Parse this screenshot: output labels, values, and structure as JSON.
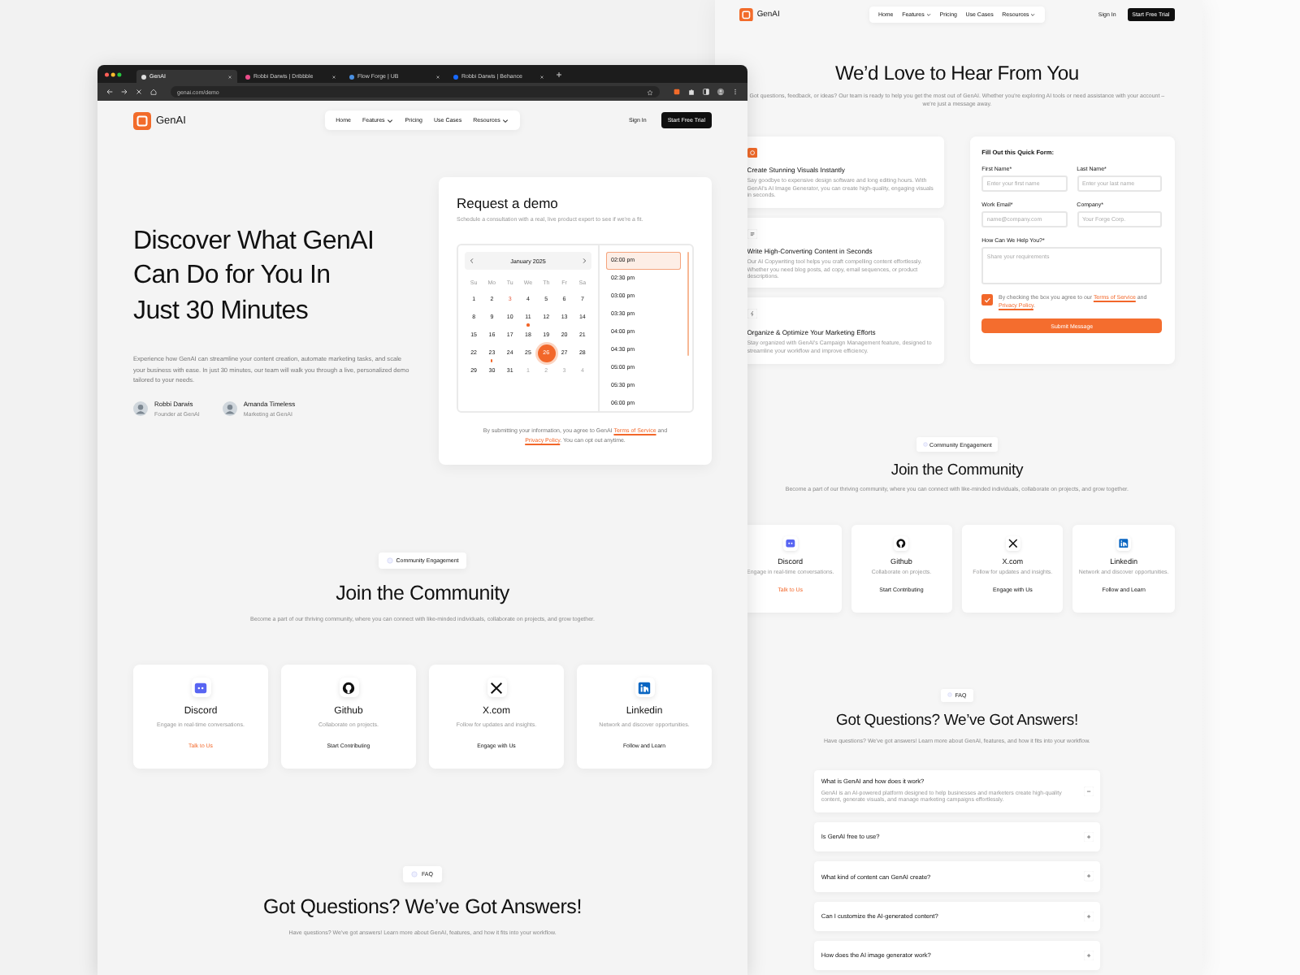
{
  "contact_page": {
    "brand": "GenAI",
    "nav": [
      {
        "label": "Home",
        "dropdown": false
      },
      {
        "label": "Features",
        "dropdown": true
      },
      {
        "label": "Pricing",
        "dropdown": false
      },
      {
        "label": "Use Cases",
        "dropdown": false
      },
      {
        "label": "Resources",
        "dropdown": true
      }
    ],
    "sign_in": "Sign In",
    "cta": "Start Free Trial",
    "title": "We’d Love to Hear From You",
    "text": "Got questions, feedback, or ideas? Our team is ready to help you get the most out of GenAI. Whether you're exploring AI tools or need assistance with your account – we're just a message away.",
    "features": [
      {
        "title": "Create Stunning Visuals Instantly",
        "text": "Say goodbye to expensive design software and long editing hours. With GenAI's AI Image Generator, you can create high-quality, engaging visuals in seconds."
      },
      {
        "title": "Write High-Converting Content in Seconds",
        "text": "Our AI Copywriting tool helps you craft compelling content effortlessly. Whether you need blog posts, ad copy, email sequences, or product descriptions."
      },
      {
        "title": "Organize & Optimize Your Marketing Efforts",
        "text": "Stay organized with GenAI's Campaign Management feature, designed to streamline your workflow and improve efficiency."
      }
    ],
    "form": {
      "title": "Fill Out this Quick Form:",
      "fields": [
        {
          "label": "First Name*",
          "placeholder": "Enter your first name",
          "kind": "input"
        },
        {
          "label": "Last Name*",
          "placeholder": "Enter your last name",
          "kind": "input"
        },
        {
          "label": "Work Email*",
          "placeholder": "name@company.com",
          "kind": "input"
        },
        {
          "label": "Company*",
          "placeholder": "Your Forge Corp.",
          "kind": "input"
        },
        {
          "label": "How Can We Help You?*",
          "placeholder": "Share your requirements",
          "kind": "textarea"
        }
      ],
      "consent": {
        "checked": true,
        "before": "By checking the box you agree to our",
        "terms": "Terms of Service",
        "and": "and",
        "privacy": "Privacy Policy",
        "after": "."
      },
      "submit": "Submit Message"
    },
    "community": {
      "badge": "Community Engagement",
      "title": "Join the Community",
      "text": "Become a part of our thriving community, where you can connect with like-minded individuals, collaborate on projects, and grow together.",
      "cards": [
        {
          "name": "Discord",
          "text": "Engage in real-time conversations.",
          "action": "Talk to Us",
          "highlighted": true
        },
        {
          "name": "Github",
          "text": "Collaborate on projects.",
          "action": "Start Contributing",
          "highlighted": false
        },
        {
          "name": "X.com",
          "text": "Follow for updates and insights.",
          "action": "Engage with Us",
          "highlighted": false
        },
        {
          "name": "Linkedin",
          "text": "Network and discover opportunities.",
          "action": "Follow and Learn",
          "highlighted": false
        }
      ]
    },
    "faq": {
      "badge": "FAQ",
      "title": "Got Questions? We’ve Got Answers!",
      "text": "Have questions? We've got answers! Learn more about GenAI, features, and how it fits into your workflow.",
      "items": [
        {
          "question": "What is GenAI and how does it work?",
          "expanded": true,
          "answer": "GenAI is an AI-powered platform designed to help businesses and marketers create high-quality content, generate visuals, and manage marketing campaigns effortlessly."
        },
        {
          "question": "Is GenAI free to use?",
          "expanded": false
        },
        {
          "question": "What kind of content can GenAI create?",
          "expanded": false
        },
        {
          "question": "Can I customize the AI-generated content?",
          "expanded": false
        },
        {
          "question": "How does the AI image generator work?",
          "expanded": false
        }
      ]
    }
  },
  "browser": {
    "tabs": [
      {
        "label": "GenAI",
        "selected": true
      },
      {
        "label": "Robbi Darwis | Dribbble",
        "selected": false
      },
      {
        "label": "Flow Forge | UB",
        "selected": false
      },
      {
        "label": "Robbi Darwis | Behance",
        "selected": false
      }
    ],
    "address": "genai.com/demo"
  },
  "demo_page": {
    "brand": "GenAI",
    "nav": [
      {
        "label": "Home",
        "dropdown": false
      },
      {
        "label": "Features",
        "dropdown": true
      },
      {
        "label": "Pricing",
        "dropdown": false
      },
      {
        "label": "Use Cases",
        "dropdown": false
      },
      {
        "label": "Resources",
        "dropdown": true
      }
    ],
    "sign_in": "Sign In",
    "cta": "Start Free Trial",
    "hero": {
      "title": "Discover What GenAI\nCan Do for You In\nJust 30 Minutes",
      "text": "Experience how GenAI can streamline your content creation, automate marketing tasks, and scale your business with ease. In just 30 minutes, our team will walk you through a live, personalized demo tailored to your needs.",
      "people": [
        {
          "name": "Robbi Darwis",
          "role": "Founder at GenAI"
        },
        {
          "name": "Amanda Timeless",
          "role": "Marketing at GenAI"
        }
      ]
    },
    "request": {
      "title": "Request a demo",
      "subtitle": "Schedule a consultation with a real, live product expert to see if we're a fit.",
      "month": "January 2025",
      "weekdays": [
        "Su",
        "Mo",
        "Tu",
        "We",
        "Th",
        "Fr",
        "Sa"
      ],
      "days": [
        {
          "label": "1",
          "selected": false,
          "muted": false,
          "today": false,
          "dot": false
        },
        {
          "label": "2",
          "selected": false,
          "muted": false,
          "today": false,
          "dot": false
        },
        {
          "label": "3",
          "selected": false,
          "muted": false,
          "today": true,
          "dot": false
        },
        {
          "label": "4",
          "selected": false,
          "muted": false,
          "today": false,
          "dot": false
        },
        {
          "label": "5",
          "selected": false,
          "muted": false,
          "today": false,
          "dot": false
        },
        {
          "label": "6",
          "selected": false,
          "muted": false,
          "today": false,
          "dot": false
        },
        {
          "label": "7",
          "selected": false,
          "muted": false,
          "today": false,
          "dot": false
        },
        {
          "label": "8",
          "selected": false,
          "muted": false,
          "today": false,
          "dot": false
        },
        {
          "label": "9",
          "selected": false,
          "muted": false,
          "today": false,
          "dot": false
        },
        {
          "label": "10",
          "selected": false,
          "muted": false,
          "today": false,
          "dot": false
        },
        {
          "label": "11",
          "selected": false,
          "muted": false,
          "today": false,
          "dot": true
        },
        {
          "label": "12",
          "selected": false,
          "muted": false,
          "today": false,
          "dot": false
        },
        {
          "label": "13",
          "selected": false,
          "muted": false,
          "today": false,
          "dot": false
        },
        {
          "label": "14",
          "selected": false,
          "muted": false,
          "today": false,
          "dot": false
        },
        {
          "label": "15",
          "selected": false,
          "muted": false,
          "today": false,
          "dot": false
        },
        {
          "label": "16",
          "selected": false,
          "muted": false,
          "today": false,
          "dot": false
        },
        {
          "label": "17",
          "selected": false,
          "muted": false,
          "today": false,
          "dot": false
        },
        {
          "label": "18",
          "selected": false,
          "muted": false,
          "today": false,
          "dot": false
        },
        {
          "label": "19",
          "selected": false,
          "muted": false,
          "today": false,
          "dot": false
        },
        {
          "label": "20",
          "selected": false,
          "muted": false,
          "today": false,
          "dot": false
        },
        {
          "label": "21",
          "selected": false,
          "muted": false,
          "today": false,
          "dot": false
        },
        {
          "label": "22",
          "selected": false,
          "muted": false,
          "today": false,
          "dot": false
        },
        {
          "label": "23",
          "selected": false,
          "muted": false,
          "today": false,
          "dot": true
        },
        {
          "label": "24",
          "selected": false,
          "muted": false,
          "today": false,
          "dot": false
        },
        {
          "label": "25",
          "selected": false,
          "muted": false,
          "today": false,
          "dot": false
        },
        {
          "label": "26",
          "selected": true,
          "muted": false,
          "today": false,
          "dot": false
        },
        {
          "label": "27",
          "selected": false,
          "muted": false,
          "today": false,
          "dot": false
        },
        {
          "label": "28",
          "selected": false,
          "muted": false,
          "today": false,
          "dot": false
        },
        {
          "label": "29",
          "selected": false,
          "muted": false,
          "today": false,
          "dot": false
        },
        {
          "label": "30",
          "selected": false,
          "muted": false,
          "today": false,
          "dot": false
        },
        {
          "label": "31",
          "selected": false,
          "muted": false,
          "today": false,
          "dot": false
        },
        {
          "label": "1",
          "selected": false,
          "muted": true,
          "today": false,
          "dot": false
        },
        {
          "label": "2",
          "selected": false,
          "muted": true,
          "today": false,
          "dot": false
        },
        {
          "label": "3",
          "selected": false,
          "muted": true,
          "today": false,
          "dot": false
        },
        {
          "label": "4",
          "selected": false,
          "muted": true,
          "today": false,
          "dot": false
        }
      ],
      "times": [
        {
          "label": "02:00 pm",
          "selected": true
        },
        {
          "label": "02:30 pm",
          "selected": false
        },
        {
          "label": "03:00 pm",
          "selected": false
        },
        {
          "label": "03:30 pm",
          "selected": false
        },
        {
          "label": "04:00 pm",
          "selected": false
        },
        {
          "label": "04:30 pm",
          "selected": false
        },
        {
          "label": "05:00 pm",
          "selected": false
        },
        {
          "label": "05:30 pm",
          "selected": false
        },
        {
          "label": "06:00 pm",
          "selected": false
        }
      ],
      "legal": {
        "before": "By submitting your information, you agree to GenAI",
        "terms": "Terms of Service",
        "and": "and",
        "privacy": "Privacy Policy",
        "after": ". You can opt out anytime."
      }
    },
    "community": {
      "badge": "Community Engagement",
      "title": "Join the Community",
      "text": "Become a part of our thriving community, where you can connect with like-minded individuals, collaborate on projects, and grow together.",
      "cards": [
        {
          "name": "Discord",
          "text": "Engage in real-time conversations.",
          "action": "Talk to Us",
          "highlighted": true
        },
        {
          "name": "Github",
          "text": "Collaborate on projects.",
          "action": "Start Contributing",
          "highlighted": false
        },
        {
          "name": "X.com",
          "text": "Follow for updates and insights.",
          "action": "Engage with Us",
          "highlighted": false
        },
        {
          "name": "Linkedin",
          "text": "Network and discover opportunities.",
          "action": "Follow and Learn",
          "highlighted": false
        }
      ]
    },
    "faq": {
      "badge": "FAQ",
      "title": "Got Questions? We’ve Got Answers!",
      "text": "Have questions? We've got answers! Learn more about GenAI, features, and how it fits into your workflow."
    }
  }
}
